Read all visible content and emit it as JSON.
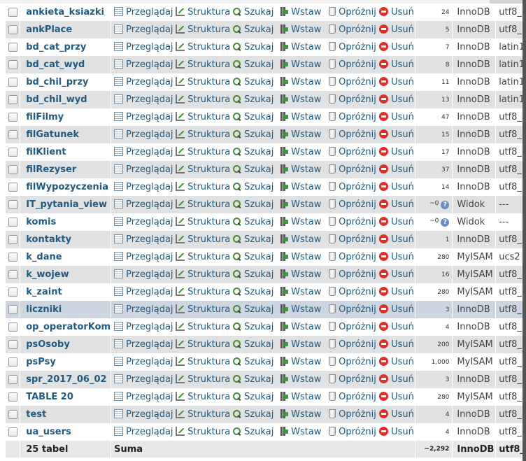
{
  "actions": {
    "browse": "Przeglądaj",
    "structure": "Struktura",
    "search": "Szukaj",
    "insert": "Wstaw",
    "empty": "Opróżnij",
    "drop": "Usuń"
  },
  "tables": [
    {
      "name": "ankieta_ksiazki",
      "rows": "24",
      "engine": "InnoDB",
      "collation": "utf8_"
    },
    {
      "name": "ankPlace",
      "rows": "5",
      "engine": "InnoDB",
      "collation": "utf8_"
    },
    {
      "name": "bd_cat_przy",
      "rows": "7",
      "engine": "InnoDB",
      "collation": "latin1"
    },
    {
      "name": "bd_cat_wyd",
      "rows": "8",
      "engine": "InnoDB",
      "collation": "latin1"
    },
    {
      "name": "bd_chil_przy",
      "rows": "11",
      "engine": "InnoDB",
      "collation": "latin1"
    },
    {
      "name": "bd_chil_wyd",
      "rows": "13",
      "engine": "InnoDB",
      "collation": "latin1"
    },
    {
      "name": "filFilmy",
      "rows": "47",
      "engine": "InnoDB",
      "collation": "utf8_"
    },
    {
      "name": "filGatunek",
      "rows": "15",
      "engine": "InnoDB",
      "collation": "utf8_"
    },
    {
      "name": "filKlient",
      "rows": "17",
      "engine": "InnoDB",
      "collation": "utf8_"
    },
    {
      "name": "filRezyser",
      "rows": "37",
      "engine": "InnoDB",
      "collation": "utf8_"
    },
    {
      "name": "filWypozyczenia",
      "rows": "14",
      "engine": "InnoDB",
      "collation": "utf8_"
    },
    {
      "name": "IT_pytania_view",
      "rows": "~0",
      "engine": "Widok",
      "collation": "---",
      "info_icon": "info-icon"
    },
    {
      "name": "komis",
      "rows": "~0",
      "engine": "Widok",
      "collation": "---",
      "info_icon": "info-icon"
    },
    {
      "name": "kontakty",
      "rows": "1",
      "engine": "InnoDB",
      "collation": "utf8_"
    },
    {
      "name": "k_dane",
      "rows": "280",
      "engine": "MyISAM",
      "collation": "ucs2"
    },
    {
      "name": "k_wojew",
      "rows": "16",
      "engine": "MyISAM",
      "collation": "utf8_"
    },
    {
      "name": "k_zaint",
      "rows": "280",
      "engine": "MyISAM",
      "collation": "utf8_"
    },
    {
      "name": "liczniki",
      "rows": "3",
      "engine": "InnoDB",
      "collation": "utf8_",
      "highlighted": true
    },
    {
      "name": "op_operatorKom",
      "rows": "4",
      "engine": "InnoDB",
      "collation": "utf8_"
    },
    {
      "name": "psOsoby",
      "rows": "200",
      "engine": "MyISAM",
      "collation": "utf8_"
    },
    {
      "name": "psPsy",
      "rows": "1,000",
      "engine": "MyISAM",
      "collation": "utf8_"
    },
    {
      "name": "spr_2017_06_02",
      "rows": "3",
      "engine": "InnoDB",
      "collation": "utf8_"
    },
    {
      "name": "TABLE 20",
      "rows": "280",
      "engine": "MyISAM",
      "collation": "utf8_"
    },
    {
      "name": "test",
      "rows": "4",
      "engine": "InnoDB",
      "collation": "utf8_"
    },
    {
      "name": "ua_users",
      "rows": "4",
      "engine": "InnoDB",
      "collation": "utf8_"
    }
  ],
  "footer": {
    "count_label": "25 tabel",
    "sum_label": "Suma",
    "rows_total": "~2,292",
    "engine": "InnoDB",
    "collation": "utf8_"
  }
}
